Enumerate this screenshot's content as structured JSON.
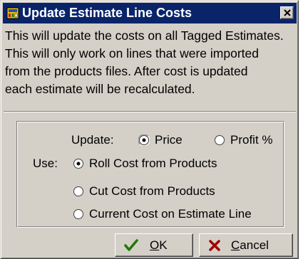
{
  "window": {
    "title": "Update Estimate Line Costs",
    "title_icon": "estimate-app-icon",
    "close_icon": "close-icon"
  },
  "description": {
    "lines": [
      "This will update the costs on all Tagged Estimates.",
      "This will only work on lines that were imported",
      "from the products files. After cost is updated",
      "each estimate will be recalculated."
    ]
  },
  "update": {
    "label": "Update:",
    "options": [
      {
        "label": "Price",
        "selected": true
      },
      {
        "label": "Profit %",
        "selected": false
      }
    ]
  },
  "use": {
    "label": "Use:",
    "options": [
      {
        "label": "Roll Cost from Products",
        "selected": true
      },
      {
        "label": "Cut Cost from Products",
        "selected": false
      },
      {
        "label": "Current Cost on Estimate Line",
        "selected": false
      }
    ]
  },
  "buttons": {
    "ok": {
      "mnemonic": "O",
      "rest": "K",
      "icon": "checkmark-icon",
      "icon_color": "#1f7a00"
    },
    "cancel": {
      "mnemonic": "C",
      "rest": "ancel",
      "icon": "x-cross-icon",
      "icon_color": "#a00000"
    }
  },
  "colors": {
    "titlebar": "#0a246a",
    "face": "#d4d0c8"
  }
}
